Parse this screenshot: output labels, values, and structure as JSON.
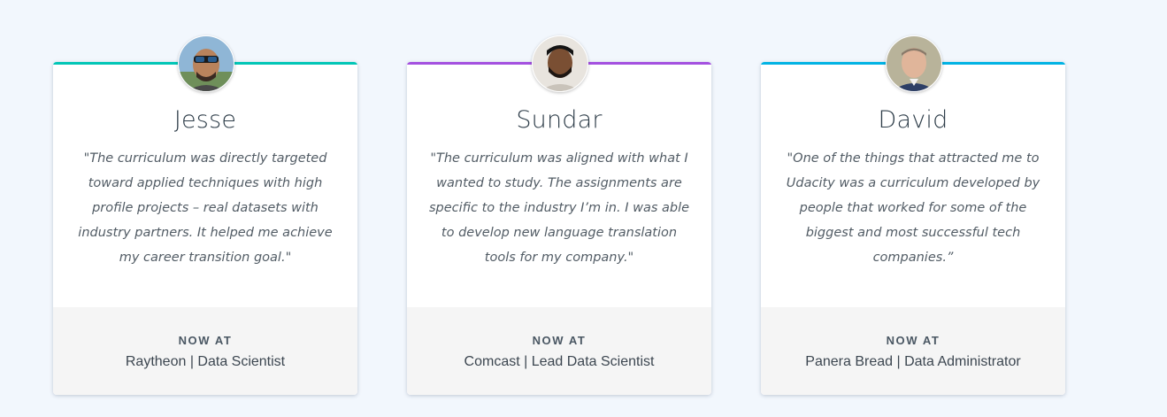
{
  "testimonials": [
    {
      "name": "Jesse",
      "quote": "\"The curriculum was directly targeted toward applied techniques with high profile projects – real datasets with industry partners. It helped me achieve my career transition goal.\"",
      "footer_label": "NOW AT",
      "role": "Raytheon | Data Scientist",
      "accent_color": "#02c6b6",
      "avatar_icon": "avatar-photo-jesse"
    },
    {
      "name": "Sundar",
      "quote": "\"The curriculum was aligned with what I wanted to study. The assignments are specific to the industry I’m in. I was able to develop new language translation tools for my company.\"",
      "footer_label": "NOW AT",
      "role": "Comcast | Lead Data Scientist",
      "accent_color": "#a451e0",
      "avatar_icon": "avatar-photo-sundar"
    },
    {
      "name": "David",
      "quote": "\"One of the things that attracted me to Udacity was a curriculum developed by people that worked for some of the biggest and most successful tech companies.”",
      "footer_label": "NOW AT",
      "role": "Panera Bread | Data Administrator",
      "accent_color": "#02b3e4",
      "avatar_icon": "avatar-photo-david"
    }
  ]
}
